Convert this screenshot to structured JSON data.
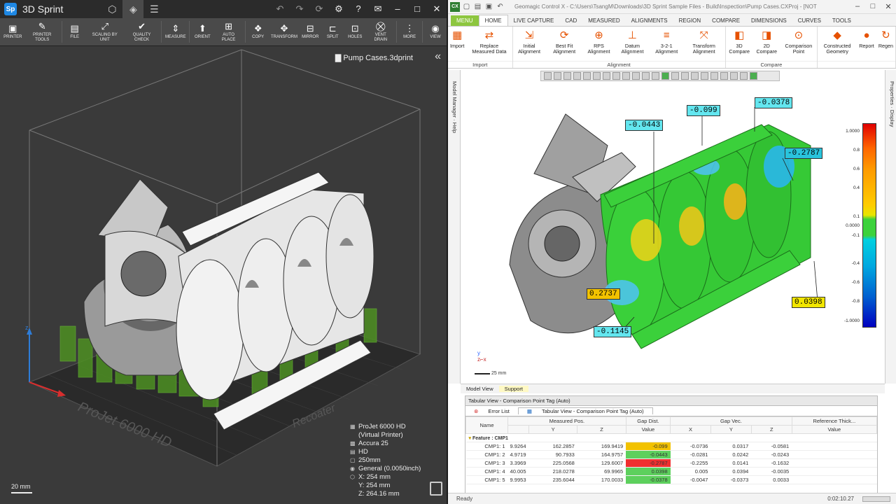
{
  "sprint": {
    "title": "3D Sprint",
    "logo": "Sp",
    "title_icons": [
      "cube-icon",
      "layers-icon",
      "menu-icon"
    ],
    "window_controls": [
      "undo-icon",
      "redo-icon",
      "refresh-icon",
      "settings-icon",
      "help-icon",
      "mail-icon",
      "minimize-icon",
      "maximize-icon",
      "close-icon"
    ],
    "toolbar": [
      {
        "label": "PRINTER",
        "icon": "printer-icon",
        "glyph": "▣"
      },
      {
        "label": "PRINTER TOOLS",
        "icon": "wrench-icon",
        "glyph": "✎"
      },
      {
        "label": "FILE",
        "icon": "file-icon",
        "glyph": "▤"
      },
      {
        "label": "SCALING BY UNIT",
        "icon": "scale-icon",
        "glyph": "⤢"
      },
      {
        "label": "QUALITY CHECK",
        "icon": "check-icon",
        "glyph": "✔"
      },
      {
        "label": "MEASURE",
        "icon": "measure-icon",
        "glyph": "⇕"
      },
      {
        "label": "ORIENT",
        "icon": "orient-icon",
        "glyph": "⬆"
      },
      {
        "label": "AUTO PLACE",
        "icon": "autoplace-icon",
        "glyph": "⊞"
      },
      {
        "label": "COPY",
        "icon": "copy-icon",
        "glyph": "❖"
      },
      {
        "label": "TRANSFORM",
        "icon": "transform-icon",
        "glyph": "✥"
      },
      {
        "label": "MIRROR",
        "icon": "mirror-icon",
        "glyph": "⊟"
      },
      {
        "label": "SPLIT",
        "icon": "split-icon",
        "glyph": "⊏"
      },
      {
        "label": "HOLES",
        "icon": "holes-icon",
        "glyph": "⊡"
      },
      {
        "label": "VENT DRAIN",
        "icon": "vent-icon",
        "glyph": "⛒"
      },
      {
        "label": "MORE",
        "icon": "more-icon",
        "glyph": "⋮"
      },
      {
        "label": "VIEW",
        "icon": "view-icon",
        "glyph": "◉"
      }
    ],
    "file_name": "Pump Cases.3dprint",
    "platform_text_1": "ProJet 6000 HD",
    "platform_text_2": "Recoater",
    "info": [
      "ProJet 6000 HD",
      "(Virtual Printer)",
      "Accura 25",
      "HD",
      "250mm",
      "General (0.0050inch)",
      "X:  254 mm",
      "Y:  254 mm",
      "Z:  264.16 mm"
    ],
    "scale_label": "20 mm"
  },
  "cx": {
    "logo": "CX",
    "path": "Geomagic Control X - C:\\Users\\TsangM\\Downloads\\3D Sprint Sample Files - Build\\Inspection\\Pump Cases.CXProj - [NOT",
    "tabs": [
      "MENU",
      "HOME",
      "LIVE CAPTURE",
      "CAD",
      "MEASURED",
      "ALIGNMENTS",
      "REGION",
      "COMPARE",
      "DIMENSIONS",
      "CURVES",
      "TOOLS"
    ],
    "ribbon_groups": [
      {
        "label": "Import",
        "buttons": [
          {
            "label": "Import",
            "glyph": "▦"
          },
          {
            "label": "Replace Measured Data",
            "glyph": "⇄"
          }
        ]
      },
      {
        "label": "Alignment",
        "buttons": [
          {
            "label": "Initial Alignment",
            "glyph": "⇲"
          },
          {
            "label": "Best Fit Alignment",
            "glyph": "⟳"
          },
          {
            "label": "RPS Alignment",
            "glyph": "⊕"
          },
          {
            "label": "Datum Alignment",
            "glyph": "⊥"
          },
          {
            "label": "3-2-1 Alignment",
            "glyph": "≡"
          },
          {
            "label": "Transform Alignment",
            "glyph": "⤧"
          }
        ]
      },
      {
        "label": "Compare",
        "buttons": [
          {
            "label": "3D Compare",
            "glyph": "◧"
          },
          {
            "label": "2D Compare",
            "glyph": "◨"
          },
          {
            "label": "Comparison Point",
            "glyph": "⊙"
          }
        ]
      },
      {
        "label": "",
        "buttons": [
          {
            "label": "Constructed Geometry",
            "glyph": "◆"
          },
          {
            "label": "Report",
            "glyph": "●"
          },
          {
            "label": "Regen",
            "glyph": "↻"
          }
        ]
      }
    ],
    "side_left": [
      "Model Manager",
      "Help"
    ],
    "side_right": [
      "Properties",
      "Display"
    ],
    "callouts": [
      "-0.0443",
      "-0.099",
      "-0.0378",
      "-0.2787",
      "0.2737",
      "0.0398",
      "-0.1145"
    ],
    "legend": [
      "1.0000",
      "0.8",
      "0.6",
      "0.4",
      "0.1",
      "0.0000",
      "-0.1",
      "-0.4",
      "-0.6",
      "-0.8",
      "-1.0000"
    ],
    "scale_label": "25 mm",
    "view_tabs": [
      "Model View",
      "Support"
    ],
    "panel_title": "Tabular View - Comparison Point Tag (Auto)",
    "subtabs": [
      "Error List",
      "Tabular View - Comparison Point Tag (Auto)"
    ],
    "table": {
      "headers_top": [
        "Name",
        "Measured Pos.",
        "Gap Dist.",
        "Gap Vec.",
        "Reference Thick..."
      ],
      "headers_sub": [
        "",
        "Y",
        "Z",
        "Value",
        "X",
        "Y",
        "Z",
        "Value"
      ],
      "feature": "Feature : CMP1",
      "rows": [
        {
          "name": "CMP1: 1",
          "x": "9.9264",
          "y": "162.2857",
          "z": "169.9419",
          "gap": "-0.099",
          "gx": "-0.0736",
          "gy": "0.0317",
          "gz": "-0.0581",
          "color": "#f2c200"
        },
        {
          "name": "CMP1: 2",
          "x": "4.9719",
          "y": "90.7933",
          "z": "164.9757",
          "gap": "-0.0443",
          "gx": "-0.0281",
          "gy": "0.0242",
          "gz": "-0.0243",
          "color": "#5dd05d"
        },
        {
          "name": "CMP1: 3",
          "x": "3.3969",
          "y": "225.0568",
          "z": "129.6007",
          "gap": "-0.2787",
          "gx": "-0.2255",
          "gy": "0.0141",
          "gz": "-0.1632",
          "color": "#f03030"
        },
        {
          "name": "CMP1: 4",
          "x": "40.005",
          "y": "218.0278",
          "z": "69.9965",
          "gap": "0.0398",
          "gx": "0.005",
          "gy": "0.0394",
          "gz": "-0.0035",
          "color": "#5dd05d"
        },
        {
          "name": "CMP1: 5",
          "x": "9.9953",
          "y": "235.6044",
          "z": "170.0033",
          "gap": "-0.0378",
          "gx": "-0.0047",
          "gy": "-0.0373",
          "gz": "0.0033",
          "color": "#5dd05d"
        }
      ]
    },
    "status": "Ready",
    "time": "0:02:10.27"
  }
}
